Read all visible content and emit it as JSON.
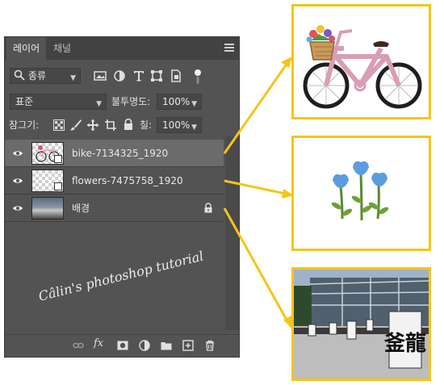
{
  "tabs": [
    {
      "label": "레이어",
      "active": true
    },
    {
      "label": "채널",
      "active": false
    }
  ],
  "filter": {
    "kind_label": "종류"
  },
  "blend": {
    "mode": "표준",
    "opacity_label": "불투명도:",
    "opacity_value": "100%"
  },
  "lock": {
    "label": "잠그기:",
    "fill_label": "칠:",
    "fill_value": "100%"
  },
  "layers": [
    {
      "name": "bike-7134325_1920",
      "visible": true,
      "selected": true,
      "locked": false
    },
    {
      "name": "flowers-7475758_1920",
      "visible": true,
      "selected": false,
      "locked": false
    },
    {
      "name": "배경",
      "visible": true,
      "selected": false,
      "locked": true
    }
  ],
  "watermark": "Câlin's photoshop tutorial",
  "bottom_bar": {
    "fx_label": "fx"
  },
  "photo_sign_text": "釜龍",
  "colors": {
    "accent": "#f5c518",
    "panel": "#535353",
    "selected_row": "#6b6b6b"
  }
}
